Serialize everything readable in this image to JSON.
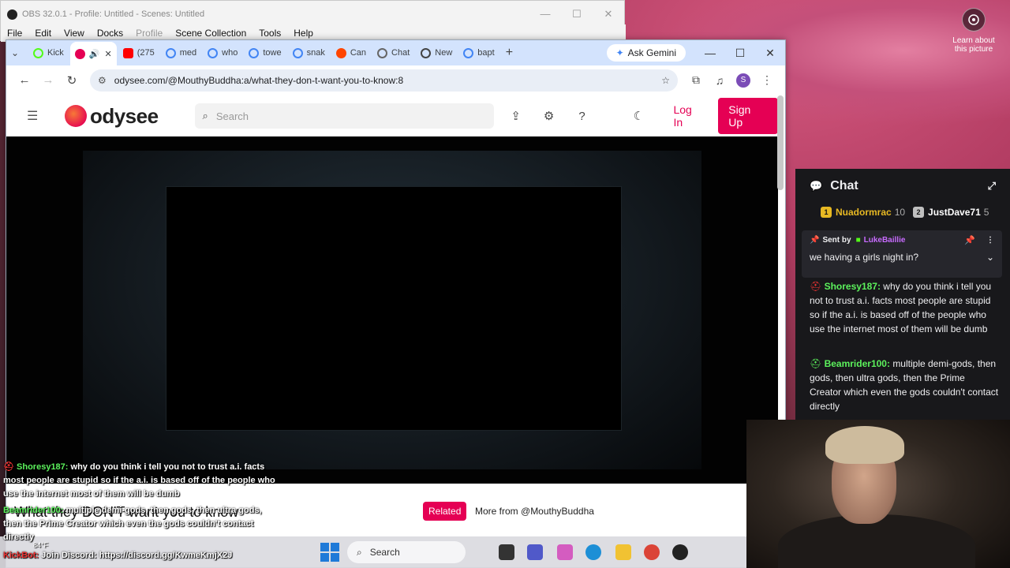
{
  "obs": {
    "title": "OBS 32.0.1 - Profile: Untitled - Scenes: Untitled",
    "menu": [
      "File",
      "Edit",
      "View",
      "Docks",
      "Profile",
      "Scene Collection",
      "Tools",
      "Help"
    ]
  },
  "desktop": {
    "lens_label_1": "Learn about",
    "lens_label_2": "this picture"
  },
  "browser": {
    "tabs": [
      {
        "label": "Kick",
        "color": "#53fc18"
      },
      {
        "label": "",
        "color": "#e50054"
      },
      {
        "label": "(275",
        "color": "#ff0000"
      },
      {
        "label": "med",
        "color": "#4285f4"
      },
      {
        "label": "who",
        "color": "#4285f4"
      },
      {
        "label": "towe",
        "color": "#4285f4"
      },
      {
        "label": "snak",
        "color": "#4285f4"
      },
      {
        "label": "Can",
        "color": "#ff4500"
      },
      {
        "label": "Chat",
        "color": "#444444"
      },
      {
        "label": "New",
        "color": "#444444"
      },
      {
        "label": "bapt",
        "color": "#4285f4"
      }
    ],
    "ask_gemini": "Ask Gemini",
    "url": "odysee.com/@MouthyBuddha:a/what-they-don-t-want-you-to-know:8",
    "profile_initial": "S"
  },
  "odysee": {
    "logo_text": "odysee",
    "search_placeholder": "Search",
    "login": "Log In",
    "signup": "Sign Up",
    "video_title": "What they DON'T want you to know",
    "related_pill": "Related",
    "more_from": "More from @MouthyBuddha"
  },
  "chat": {
    "title": "Chat",
    "gifters": [
      {
        "name": "Nuadormrac",
        "count": "10",
        "color": "#e8b923"
      },
      {
        "name": "JustDave71",
        "count": "5",
        "color": "#c0c0c0"
      }
    ],
    "pinned": {
      "sent_by_label": "Sent by",
      "sender": "LukeBaillie",
      "text": "we having a girls night in?"
    },
    "messages": [
      {
        "user": "Shoresy187:",
        "text": "why do you think i tell you not to trust a.i. facts most people are stupid so if the a.i. is based off of the people who use the internet most of them will be dumb",
        "color": "#5cf25c"
      },
      {
        "user": "Beamrider100:",
        "text": "multiple demi-gods, then gods, then ultra gods, then the Prime Creator which even the gods couldn't contact directly",
        "color": "#5cf25c"
      }
    ]
  },
  "overlay": {
    "messages": [
      {
        "user": "Shoresy187:",
        "text": "why do you think i tell you not to trust a.i. facts most people are stupid so if the a.i. is based off of the people who use the internet most of them will be dumb"
      },
      {
        "user": "Beamrider100:",
        "text": "multiple demi-gods, then gods, then ultra gods, then the Prime Creator which even the gods couldn't contact directly"
      }
    ],
    "weather": "84°F",
    "kickbot_user": "KickBot:",
    "kickbot_text": "Join Discord: https://discord.gg/KwmeKmjX2J"
  },
  "taskbar": {
    "search": "Search"
  }
}
